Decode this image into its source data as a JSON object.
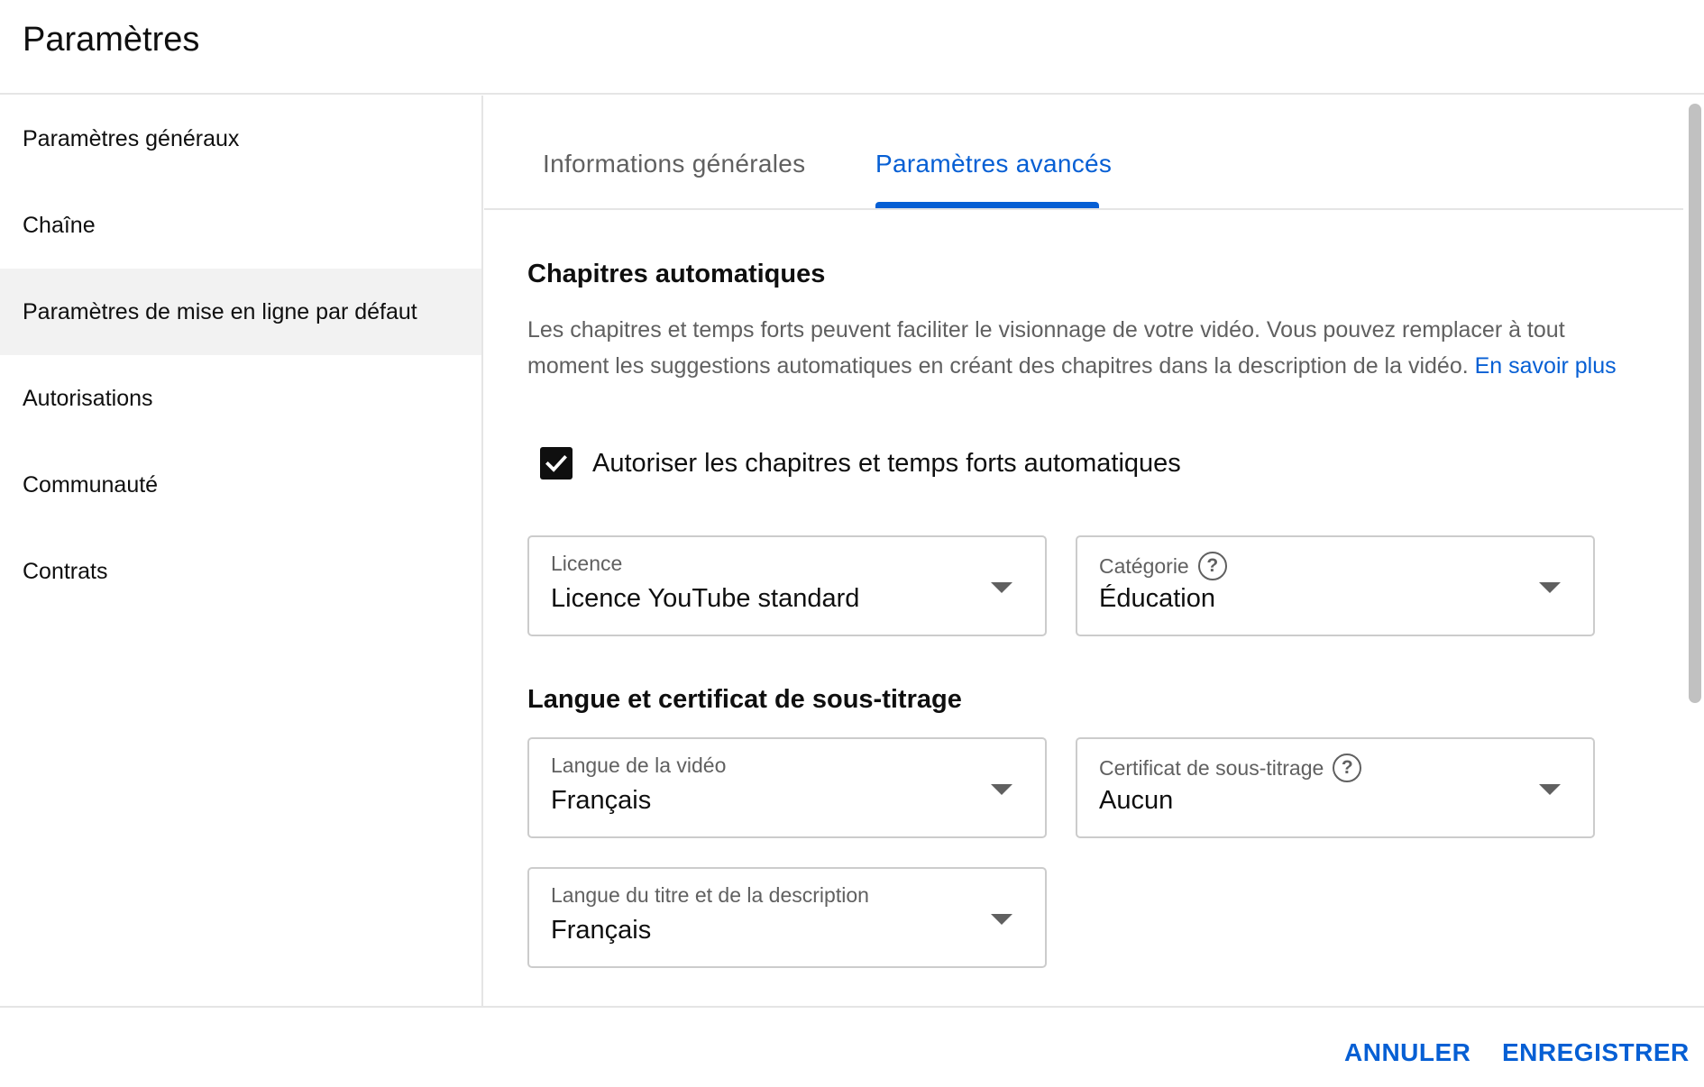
{
  "header": {
    "title": "Paramètres"
  },
  "sidebar": {
    "items": [
      {
        "label": "Paramètres généraux"
      },
      {
        "label": "Chaîne"
      },
      {
        "label": "Paramètres de mise en ligne par défaut"
      },
      {
        "label": "Autorisations"
      },
      {
        "label": "Communauté"
      },
      {
        "label": "Contrats"
      }
    ],
    "active_index": 2
  },
  "tabs": [
    {
      "label": "Informations générales"
    },
    {
      "label": "Paramètres avancés"
    }
  ],
  "chapters": {
    "title": "Chapitres automatiques",
    "description": "Les chapitres et temps forts peuvent faciliter le visionnage de votre vidéo. Vous pouvez remplacer à tout moment les suggestions automatiques en créant des chapitres dans la description de la vidéo.",
    "learn_more": "En savoir plus",
    "checkbox_label": "Autoriser les chapitres et temps forts automatiques",
    "checked": true
  },
  "license": {
    "label": "Licence",
    "value": "Licence YouTube standard"
  },
  "category": {
    "label": "Catégorie",
    "value": "Éducation"
  },
  "language_section": {
    "title": "Langue et certificat de sous-titrage"
  },
  "video_language": {
    "label": "Langue de la vidéo",
    "value": "Français"
  },
  "caption_cert": {
    "label": "Certificat de sous-titrage",
    "value": "Aucun"
  },
  "title_language": {
    "label": "Langue du titre et de la description",
    "value": "Français"
  },
  "footer": {
    "cancel": "ANNULER",
    "save": "ENREGISTRER"
  },
  "icons": {
    "help": "help-icon",
    "checkmark": "check-icon",
    "dropdown": "caret-down-icon"
  },
  "colors": {
    "accent": "#065fd4",
    "active_bg": "#f2f2f2",
    "text_secondary": "#606060"
  }
}
